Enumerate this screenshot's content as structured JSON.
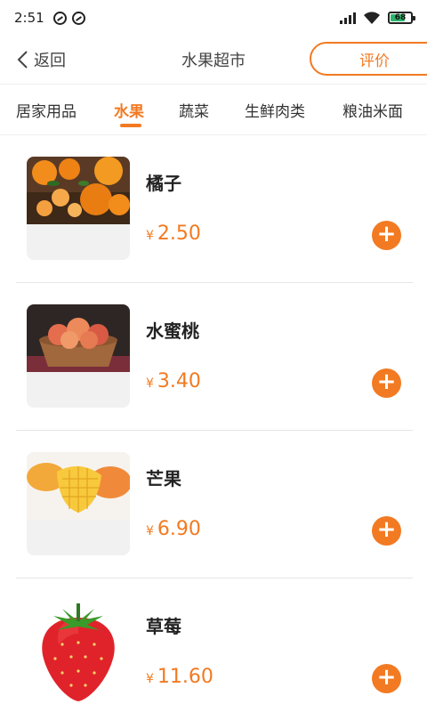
{
  "status_bar": {
    "time": "2:51",
    "battery": "68"
  },
  "header": {
    "back_label": "返回",
    "title": "水果超市",
    "review_label": "评价"
  },
  "tabs": [
    {
      "label": "居家用品",
      "active": false
    },
    {
      "label": "水果",
      "active": true
    },
    {
      "label": "蔬菜",
      "active": false
    },
    {
      "label": "生鲜肉类",
      "active": false
    },
    {
      "label": "粮油米面",
      "active": false
    }
  ],
  "products": [
    {
      "name": "橘子",
      "currency": "¥",
      "price": "2.50",
      "image": "tangerine-image"
    },
    {
      "name": "水蜜桃",
      "currency": "¥",
      "price": "3.40",
      "image": "peach-image"
    },
    {
      "name": "芒果",
      "currency": "¥",
      "price": "6.90",
      "image": "mango-image"
    },
    {
      "name": "草莓",
      "currency": "¥",
      "price": "11.60",
      "image": "strawberry-image"
    }
  ],
  "colors": {
    "accent": "#f27a22",
    "divider": "#e6e6e6"
  },
  "icons": {
    "add": "plus-icon",
    "back": "chevron-left-icon"
  }
}
